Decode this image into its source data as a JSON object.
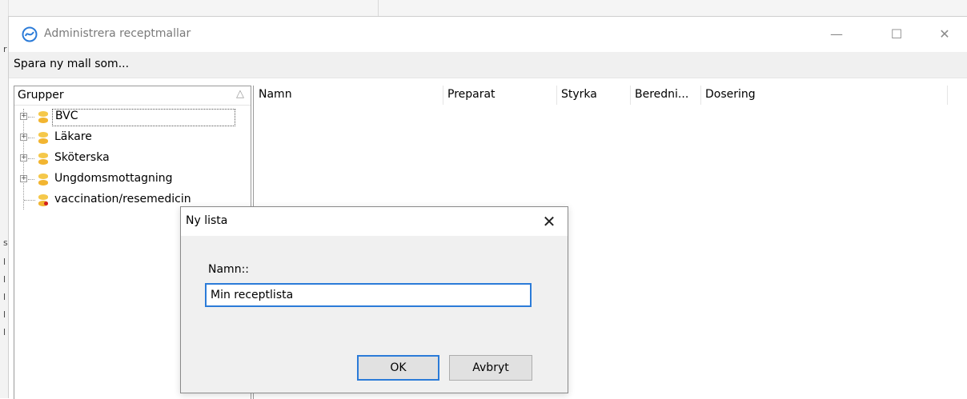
{
  "window": {
    "title": "Administrera receptmallar",
    "controls": {
      "minimize": "—",
      "maximize": "☐",
      "close": "✕"
    }
  },
  "menubar": {
    "save_as_label": "Spara ny mall som..."
  },
  "groups": {
    "header": "Grupper",
    "sort_icon": "△",
    "items": [
      {
        "label": "BVC",
        "expandable": true,
        "selected": true
      },
      {
        "label": "Läkare",
        "expandable": true
      },
      {
        "label": "Sköterska",
        "expandable": true
      },
      {
        "label": "Ungdomsmottagning",
        "expandable": true
      },
      {
        "label": "vaccination/resemedicin",
        "expandable": false
      }
    ]
  },
  "list": {
    "columns": [
      "Namn",
      "Preparat",
      "Styrka",
      "Beredni...",
      "Dosering"
    ]
  },
  "dialog": {
    "title": "Ny lista",
    "close_glyph": "✕",
    "name_label": "Namn::",
    "name_value": "Min receptlista",
    "ok_label": "OK",
    "cancel_label": "Avbryt"
  },
  "background_glyphs": [
    "r",
    "s",
    "l",
    "l",
    "l",
    "l",
    "l"
  ],
  "colors": {
    "accent": "#2b7bd8",
    "db_icon": "#f5c84a",
    "badge": "#d21f1f",
    "logo": "#2b7bd8"
  }
}
